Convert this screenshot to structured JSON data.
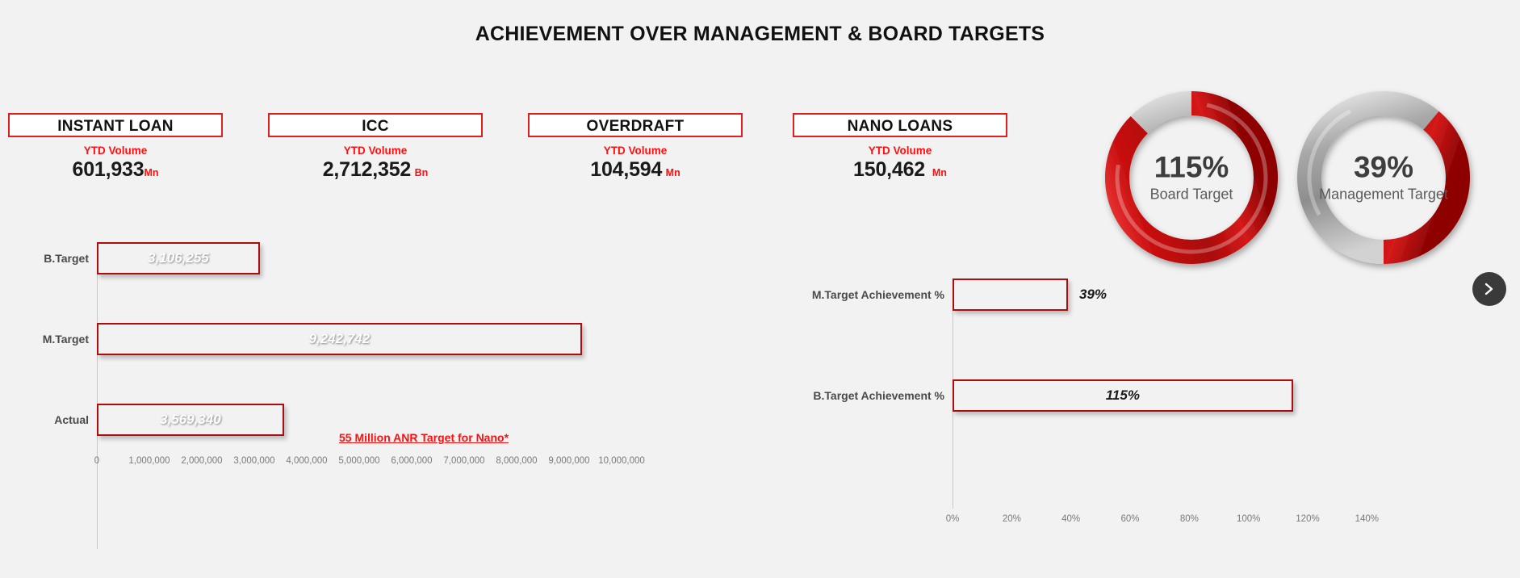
{
  "title": "ACHIEVEMENT OVER MANAGEMENT & BOARD TARGETS",
  "kpis": [
    {
      "name": "INSTANT LOAN",
      "sub": "YTD Volume",
      "value": "601,933",
      "unit": "Mn"
    },
    {
      "name": "ICC",
      "sub": "YTD Volume",
      "value": "2,712,352",
      "unit": "Bn"
    },
    {
      "name": "OVERDRAFT",
      "sub": "YTD Volume",
      "value": "104,594",
      "unit": "Mn"
    },
    {
      "name": "NANO LOANS",
      "sub": "YTD Volume",
      "value": "150,462",
      "unit": "Mn"
    }
  ],
  "donuts": [
    {
      "percent": "115%",
      "label": "Board Target",
      "value": 115
    },
    {
      "percent": "39%",
      "label": "Management Target",
      "value": 39
    }
  ],
  "annotation": "55 Million ANR Target for Nano*",
  "next_button": {
    "icon": "chevron-right-icon"
  },
  "colors": {
    "accent_red": "#e02020",
    "bright_red": "#ff1010",
    "bar_red": "#c90f0f",
    "gray_track": "#b8b8b8",
    "background": "#f2f2f2",
    "text_dark": "#1a1a1a"
  },
  "chart_data": [
    {
      "type": "bar",
      "orientation": "horizontal",
      "name": "volume-chart",
      "title": "",
      "xlabel": "",
      "ylabel": "",
      "categories": [
        "B.Target",
        "M.Target",
        "Actual"
      ],
      "values": [
        3106255,
        9242742,
        3569340
      ],
      "data_labels": [
        "3,106,255",
        "9,242,742",
        "3,569,340"
      ],
      "xlim": [
        0,
        10000000
      ],
      "xticks": [
        0,
        1000000,
        2000000,
        3000000,
        4000000,
        5000000,
        6000000,
        7000000,
        8000000,
        9000000,
        10000000
      ],
      "xtick_labels": [
        "0",
        "1,000,000",
        "2,000,000",
        "3,000,000",
        "4,000,000",
        "5,000,000",
        "6,000,000",
        "7,000,000",
        "8,000,000",
        "9,000,000",
        "10,000,000"
      ],
      "grid": false,
      "legend": false
    },
    {
      "type": "bar",
      "orientation": "horizontal",
      "name": "achievement-chart",
      "title": "",
      "xlabel": "",
      "ylabel": "",
      "categories": [
        "M.Target Achievement %",
        "B.Target Achievement %"
      ],
      "values": [
        39,
        115
      ],
      "data_labels": [
        "39%",
        "115%"
      ],
      "xlim": [
        0,
        150
      ],
      "xticks": [
        0,
        20,
        40,
        60,
        80,
        100,
        120,
        140
      ],
      "xtick_labels": [
        "0%",
        "20%",
        "40%",
        "60%",
        "80%",
        "100%",
        "120%",
        "140%"
      ],
      "grid": false,
      "legend": false
    }
  ]
}
